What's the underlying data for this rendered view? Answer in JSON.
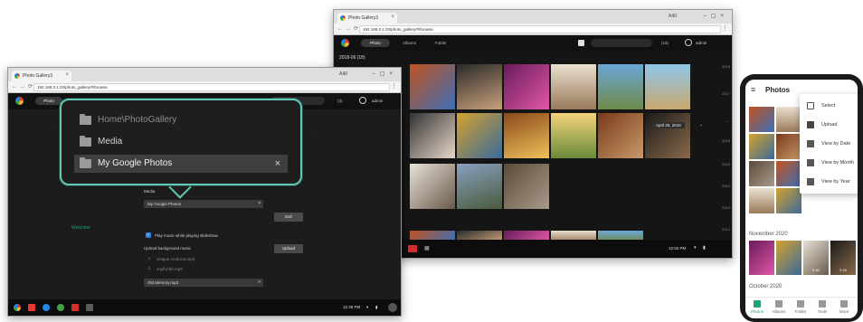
{
  "window2": {
    "tab_title": "Photo Gallery3",
    "url": "192.168.0.1:20/photo_gallery/#/browse",
    "title_right": "A로I",
    "nav": {
      "photo": "Photo",
      "albums": "Albums",
      "folder": "Folder"
    },
    "admin": "admin",
    "count": "(19)",
    "date_header": "2018-06 (18)",
    "tooltip": "April 28, 2018",
    "time": "12:55 PM",
    "years": [
      "2018",
      "2017",
      "2016",
      "2015",
      "2014",
      "2013",
      "2012",
      "2011"
    ]
  },
  "window1": {
    "tab_title": "Photo Gallery3",
    "url": "192.168.0.1:20/photo_gallery/#/browse",
    "title_right": "A로I",
    "nav_photo": "Photo",
    "admin": "admin",
    "count": "(3)",
    "welcome": "Welcome",
    "media_label": "Media",
    "selected_folder": "My Google Photos",
    "exit_button": "Exit",
    "play_music_label": "Play music while playing slideshow",
    "upload_music_label": "Upload background music",
    "upload_button": "Upload",
    "music_files": [
      "Unique HAB.m4.mp3",
      "Joyful life.mp3"
    ],
    "selected_music": "Old Memory.mp3",
    "time": "12:38 PM"
  },
  "callout": {
    "items": [
      "Home\\PhotoGallery",
      "Media",
      "My Google Photos"
    ],
    "selected_index": 2
  },
  "phone": {
    "title": "Photos",
    "menu": [
      "Select",
      "Upload",
      "View by Date",
      "View by Month",
      "View by Year"
    ],
    "section_nov": "November 2020",
    "section_oct": "October 2020",
    "badges": [
      "5:40",
      "3:18"
    ],
    "bottom_nav": [
      "Photos",
      "Albums",
      "Folder",
      "Tools",
      "More"
    ],
    "active_nav_index": 0
  },
  "colors": {
    "accent_teal": "#5fc9b4",
    "brand_green": "#1fa27a",
    "checkbox_blue": "#2c7be5"
  }
}
